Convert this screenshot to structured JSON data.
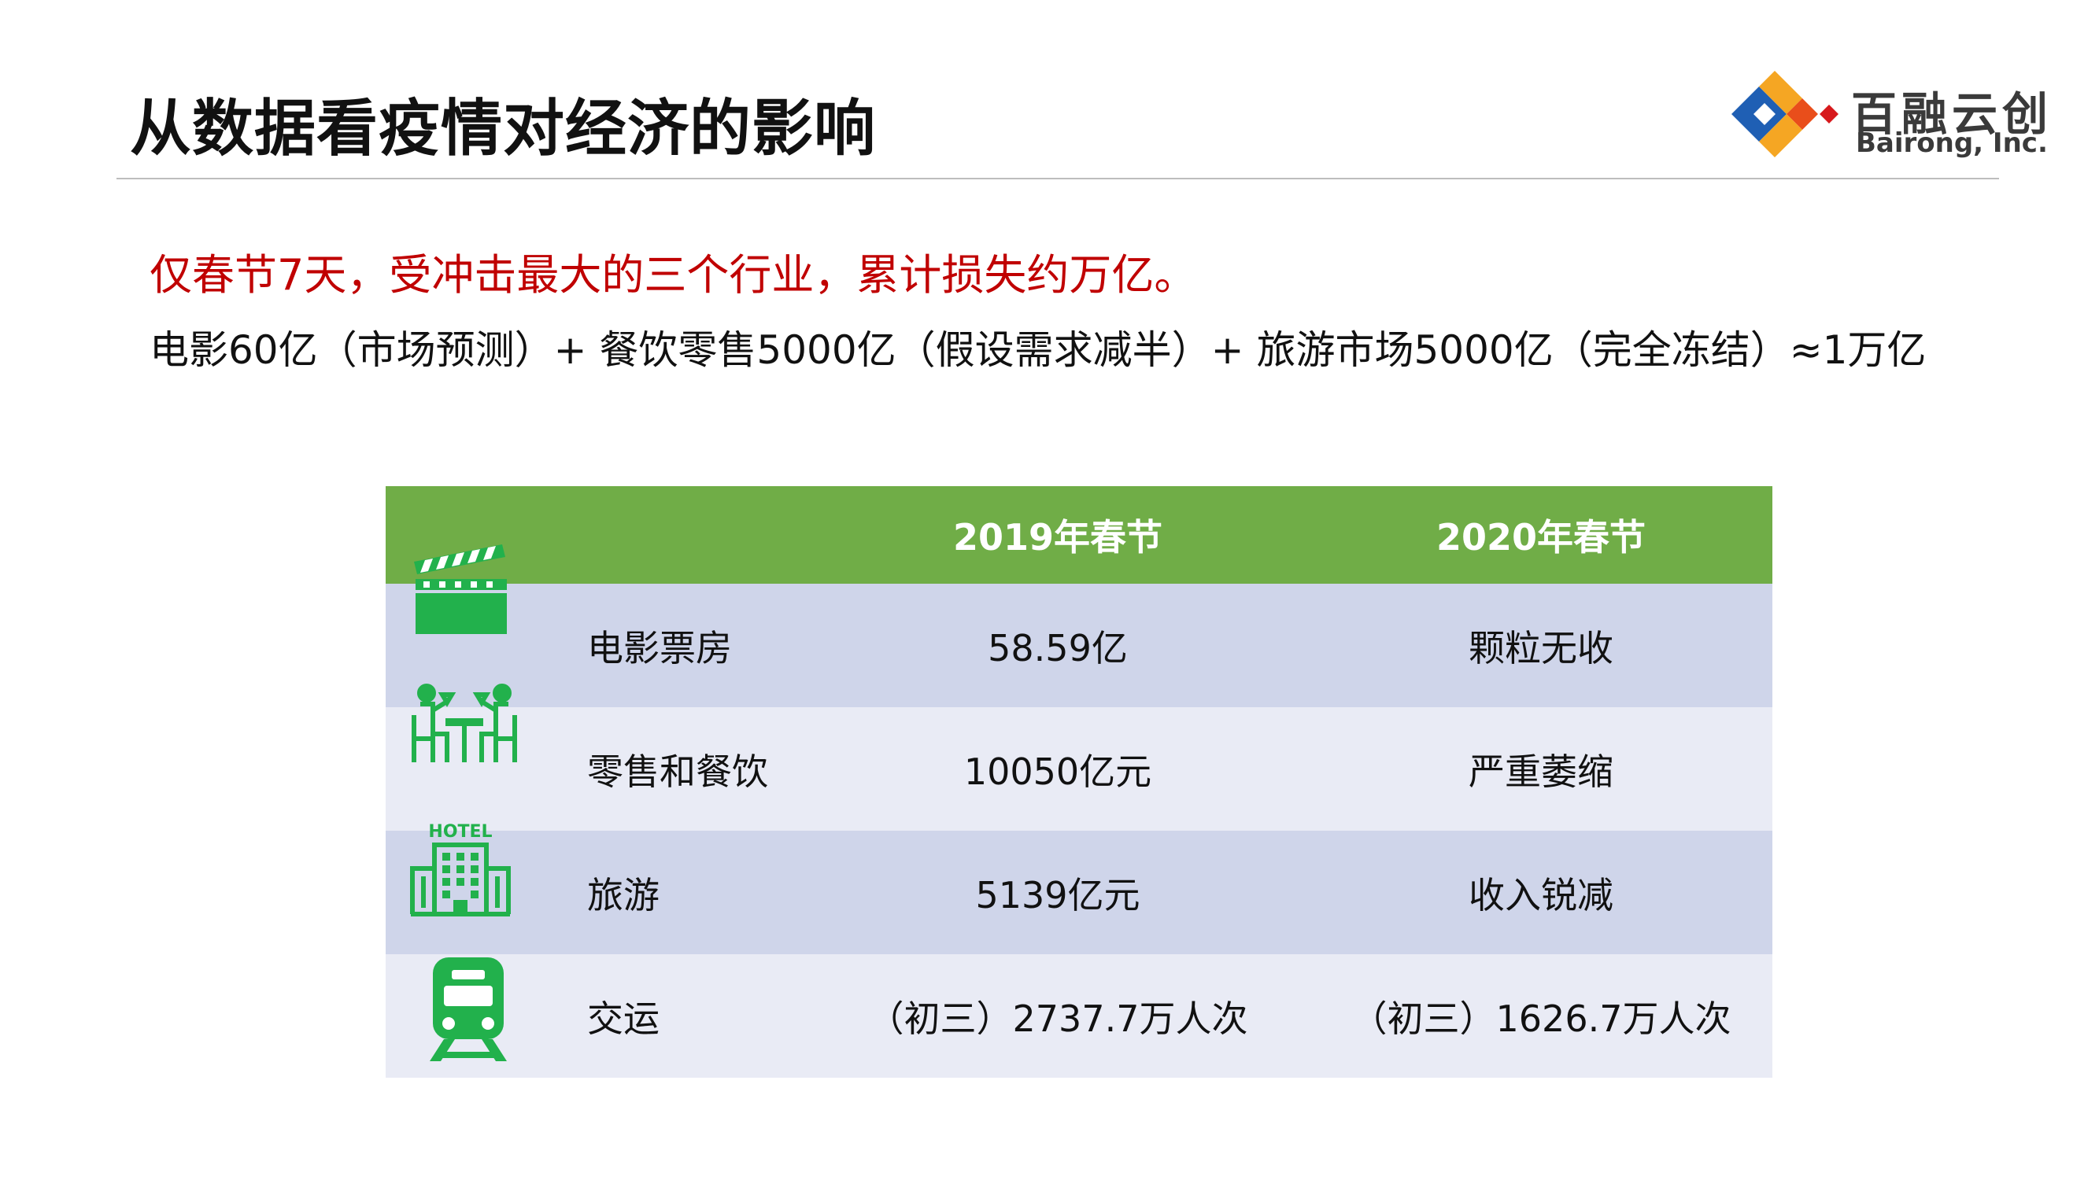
{
  "page": {
    "title": "从数据看疫情对经济的影响",
    "headline": "仅春节7天，受冲击最大的三个行业，累计损失约万亿。",
    "formula": "电影60亿（市场预测）+ 餐饮零售5000亿（假设需求减半）+ 旅游市场5000亿（完全冻结）≈1万亿"
  },
  "logo": {
    "name_cn": "百融云创",
    "name_en": "Bairong, Inc.",
    "colors": [
      "#1f5fb4",
      "#f5a623",
      "#e94e1b",
      "#d7191c"
    ]
  },
  "table": {
    "headers": [
      "",
      "2019年春节",
      "2020年春节"
    ],
    "rows": [
      {
        "icon": "clapperboard-icon",
        "name": "电影票房",
        "y2019": "58.59亿",
        "y2020": "颗粒无收"
      },
      {
        "icon": "dining-icon",
        "name": "零售和餐饮",
        "y2019": "10050亿元",
        "y2020": "严重萎缩"
      },
      {
        "icon": "hotel-icon",
        "name": "旅游",
        "y2019": "5139亿元",
        "y2020": "收入锐减",
        "icon_text": "HOTEL"
      },
      {
        "icon": "train-icon",
        "name": "交运",
        "y2019": "（初三）2737.7万人次",
        "y2020": "（初三）1626.7万人次"
      }
    ],
    "colors": {
      "header": "#70ad47",
      "row_odd": "#cfd5ea",
      "row_even": "#e9ebf5",
      "icon": "#22b14c"
    }
  }
}
